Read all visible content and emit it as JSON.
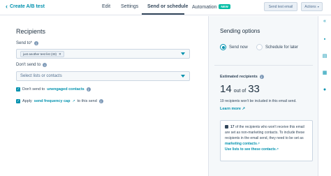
{
  "topbar": {
    "back_label": "Create A/B test",
    "tabs": [
      {
        "label": "Edit"
      },
      {
        "label": "Settings"
      },
      {
        "label": "Send or schedule"
      },
      {
        "label": "Automation",
        "badge": "NEW"
      }
    ],
    "send_test_label": "Send test email",
    "actions_label": "Actions"
  },
  "recipients": {
    "heading": "Recipients",
    "send_to_label": "Send to*",
    "send_to_chip": "just another test list (33)",
    "dont_send_label": "Don't send to",
    "dont_send_placeholder": "Select lists or contacts",
    "unengaged_prefix": "Don't send to",
    "unengaged_link": "unengaged contacts",
    "freq_prefix": "Apply",
    "freq_link": "send frequency cap",
    "freq_suffix": "to this send"
  },
  "sending_options": {
    "title": "Sending options",
    "send_now": "Send now",
    "schedule_later": "Schedule for later"
  },
  "estimate": {
    "title": "Estimated recipients",
    "count": "14",
    "out_of": "out of",
    "total": "33",
    "note": "19 recipients won't be included in this email send.",
    "learn_more": "Learn more",
    "callout_count": "17",
    "callout_text": "of the recipients who won't receive this email are set as non-marketing contacts. To include these recipients in the email send, they need to be set as",
    "callout_link": "marketing contacts",
    "callout_link2": "Use lists to see these contacts"
  },
  "colors": {
    "accent": "#0091ae",
    "badge": "#00bda5",
    "panel": "#f5f8fa"
  }
}
